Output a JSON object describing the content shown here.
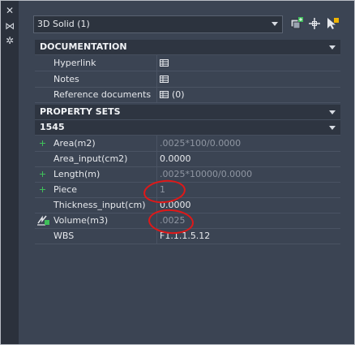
{
  "left_strip": {
    "icons": [
      "close-icon",
      "collapse-icon",
      "settings-icon"
    ],
    "close_glyph": "✕",
    "collapse_glyph": "⋈",
    "settings_glyph": "✲"
  },
  "selector": {
    "selected": "3D Solid (1)"
  },
  "toolbar": {
    "icons": [
      "select-objects-icon",
      "pick-add-icon",
      "toggle-pickadd-icon"
    ]
  },
  "documentation": {
    "title": "DOCUMENTATION",
    "rows": [
      {
        "label": "Hyperlink",
        "value": ""
      },
      {
        "label": "Notes",
        "value": ""
      },
      {
        "label": "Reference documents",
        "value": "(0)"
      }
    ]
  },
  "property_sets": {
    "title": "PROPERTY SETS",
    "set_name": "1545",
    "rows": [
      {
        "label": "Area(m2)",
        "value": ".0025*100/0.0000",
        "dim": true,
        "marker": "plus"
      },
      {
        "label": "Area_input(cm2)",
        "value": "0.0000",
        "dim": false,
        "marker": ""
      },
      {
        "label": "Length(m)",
        "value": ".0025*10000/0.0000",
        "dim": true,
        "marker": "plus"
      },
      {
        "label": "Piece",
        "value": "1",
        "dim": true,
        "marker": "plus"
      },
      {
        "label": "Thickness_input(cm)",
        "value": "0.0000",
        "dim": false,
        "marker": ""
      },
      {
        "label": "Volume(m3)",
        "value": ".0025",
        "dim": true,
        "marker": "formula"
      },
      {
        "label": "WBS",
        "value": "F1.1.1.5.12",
        "dim": false,
        "marker": ""
      }
    ]
  },
  "colors": {
    "background": "#3b4453",
    "header": "#2e3541",
    "annotation": "#e01818",
    "plus": "#3fbf5a"
  }
}
